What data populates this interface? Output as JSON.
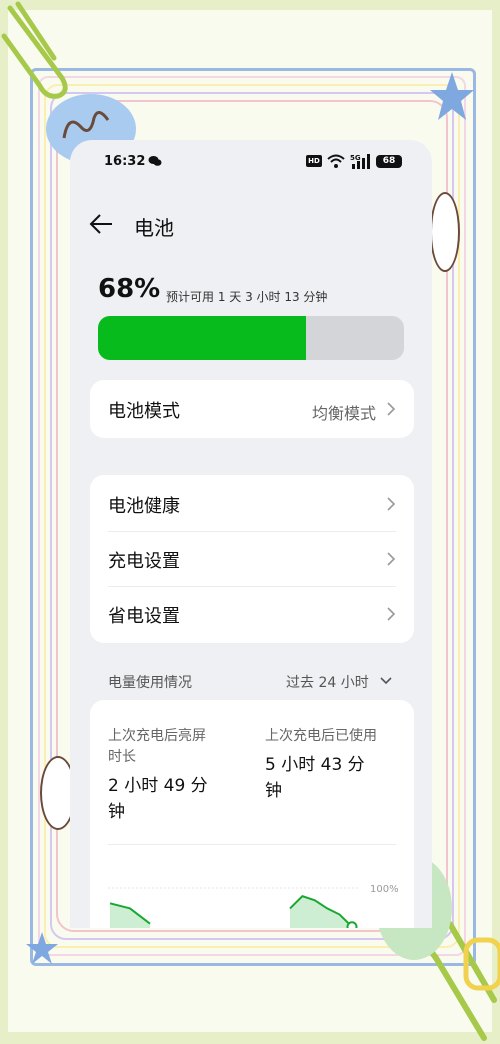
{
  "status_bar": {
    "time": "16:32",
    "hd_label": "HD",
    "network_label": "5G",
    "battery_level": "68"
  },
  "header": {
    "title": "电池"
  },
  "battery": {
    "percent_label": "68%",
    "percent_value": 68,
    "estimate": "预计可用 1 天 3 小时 13 分钟",
    "bar_color": "#08bb1c"
  },
  "mode_card": {
    "label": "电池模式",
    "value": "均衡模式"
  },
  "settings_card": {
    "items": [
      {
        "label": "电池健康"
      },
      {
        "label": "充电设置"
      },
      {
        "label": "省电设置"
      }
    ]
  },
  "usage": {
    "title": "电量使用情况",
    "range": "过去 24 小时",
    "screen_on_label_1": "上次充电后亮屏",
    "screen_on_label_2": "时长",
    "screen_on_value_1": "2 小时 49 分",
    "screen_on_value_2": "钟",
    "used_label": "上次充电后已使用",
    "used_value_1": "5 小时 43 分",
    "used_value_2": "钟"
  },
  "chart_data": {
    "type": "area",
    "y_tick_label": "100%",
    "ylim": [
      0,
      100
    ],
    "grid": true,
    "series": [
      {
        "values": [
          85,
          80,
          65
        ]
      },
      {
        "values": [
          80,
          92,
          88,
          80,
          74,
          62
        ]
      }
    ],
    "color": "#18a832"
  }
}
